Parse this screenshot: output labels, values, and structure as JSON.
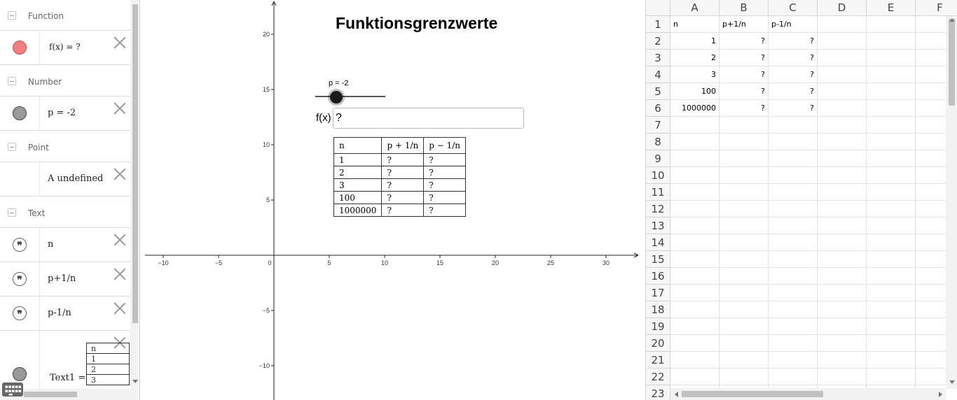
{
  "algebra": {
    "categories": {
      "function": "Function",
      "number": "Number",
      "point": "Point",
      "text": "Text"
    },
    "items": {
      "f": {
        "value": "f(x)  =  ?",
        "color": "#f08080"
      },
      "p": {
        "value": "p  =  -2",
        "color": "#999999"
      },
      "a": {
        "value": "A  undefined"
      },
      "t_n": {
        "value": "n"
      },
      "t_p_plus": {
        "value": "p+1/n"
      },
      "t_p_minus": {
        "value": "p-1/n"
      },
      "text1": {
        "value": "Text1  =",
        "color": "#999999"
      }
    },
    "mini_table": [
      "n",
      "1",
      "2",
      "3"
    ]
  },
  "graphics": {
    "title": "Funktionsgrenzwerte",
    "slider_label": "p = -2",
    "fx_label": "f(x)",
    "fx_value": "?",
    "x_ticks": [
      "−10",
      "−5",
      "0",
      "5",
      "10",
      "15",
      "20",
      "25",
      "30"
    ],
    "y_ticks": [
      "20",
      "15",
      "10",
      "5",
      "−5",
      "−10"
    ],
    "table": {
      "header": [
        "n",
        "p + 1/n",
        "p − 1/n"
      ],
      "rows": [
        [
          "1",
          "?",
          "?"
        ],
        [
          "2",
          "?",
          "?"
        ],
        [
          "3",
          "?",
          "?"
        ],
        [
          "100",
          "?",
          "?"
        ],
        [
          "1000000",
          "?",
          "?"
        ]
      ]
    }
  },
  "spreadsheet": {
    "columns": [
      "A",
      "B",
      "C",
      "D",
      "E",
      "F"
    ],
    "row_numbers": [
      "1",
      "2",
      "3",
      "4",
      "5",
      "6",
      "7",
      "8",
      "9",
      "10",
      "11",
      "12",
      "13",
      "14",
      "15",
      "16",
      "17",
      "18",
      "19",
      "20",
      "21",
      "22",
      "23"
    ],
    "header_row": [
      "n",
      "p+1/n",
      "p-1/n"
    ],
    "data_rows": [
      [
        "1",
        "?",
        "?"
      ],
      [
        "2",
        "?",
        "?"
      ],
      [
        "3",
        "?",
        "?"
      ],
      [
        "100",
        "?",
        "?"
      ],
      [
        "1000000",
        "?",
        "?"
      ]
    ]
  }
}
